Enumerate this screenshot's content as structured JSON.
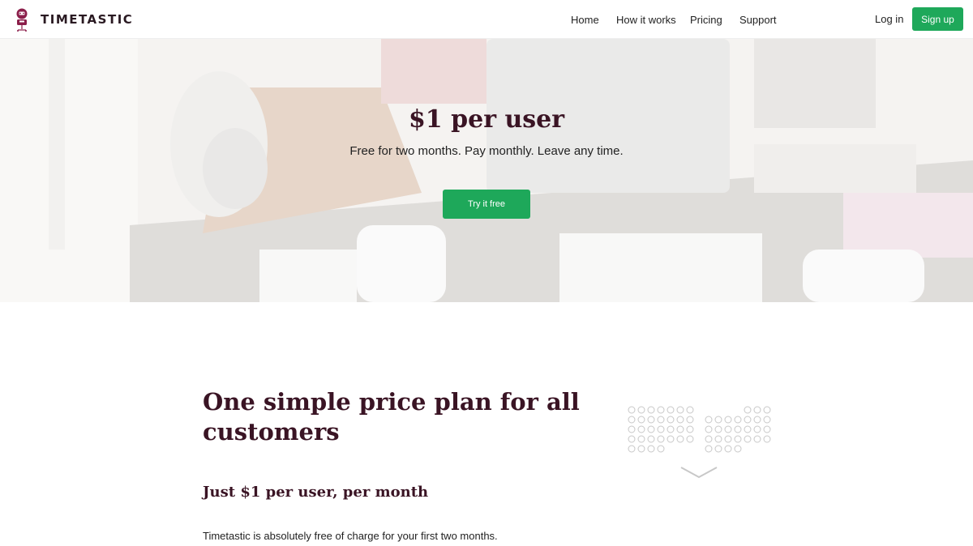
{
  "brand": {
    "name": "TIMETASTIC",
    "icon": "timetastic-logo-icon",
    "color": "#8b1e4a"
  },
  "nav": {
    "items": [
      {
        "label": "Home"
      },
      {
        "label": "How it works"
      },
      {
        "label": "Pricing"
      },
      {
        "label": "Support"
      }
    ],
    "login_label": "Log in",
    "signup_label": "Sign up"
  },
  "hero": {
    "title": "$1 per user",
    "subtitle": "Free for two months.  Pay monthly.  Leave any time.",
    "cta_label": "Try it free"
  },
  "pricing": {
    "title": "One simple price plan for all customers",
    "subtitle": "Just $1 per user, per month",
    "body": "Timetastic is absolutely free of charge for your first two months.",
    "illustration_icon": "calendar-dots-icon"
  },
  "colors": {
    "accent": "#1ea85a",
    "heading": "#3a1424"
  }
}
